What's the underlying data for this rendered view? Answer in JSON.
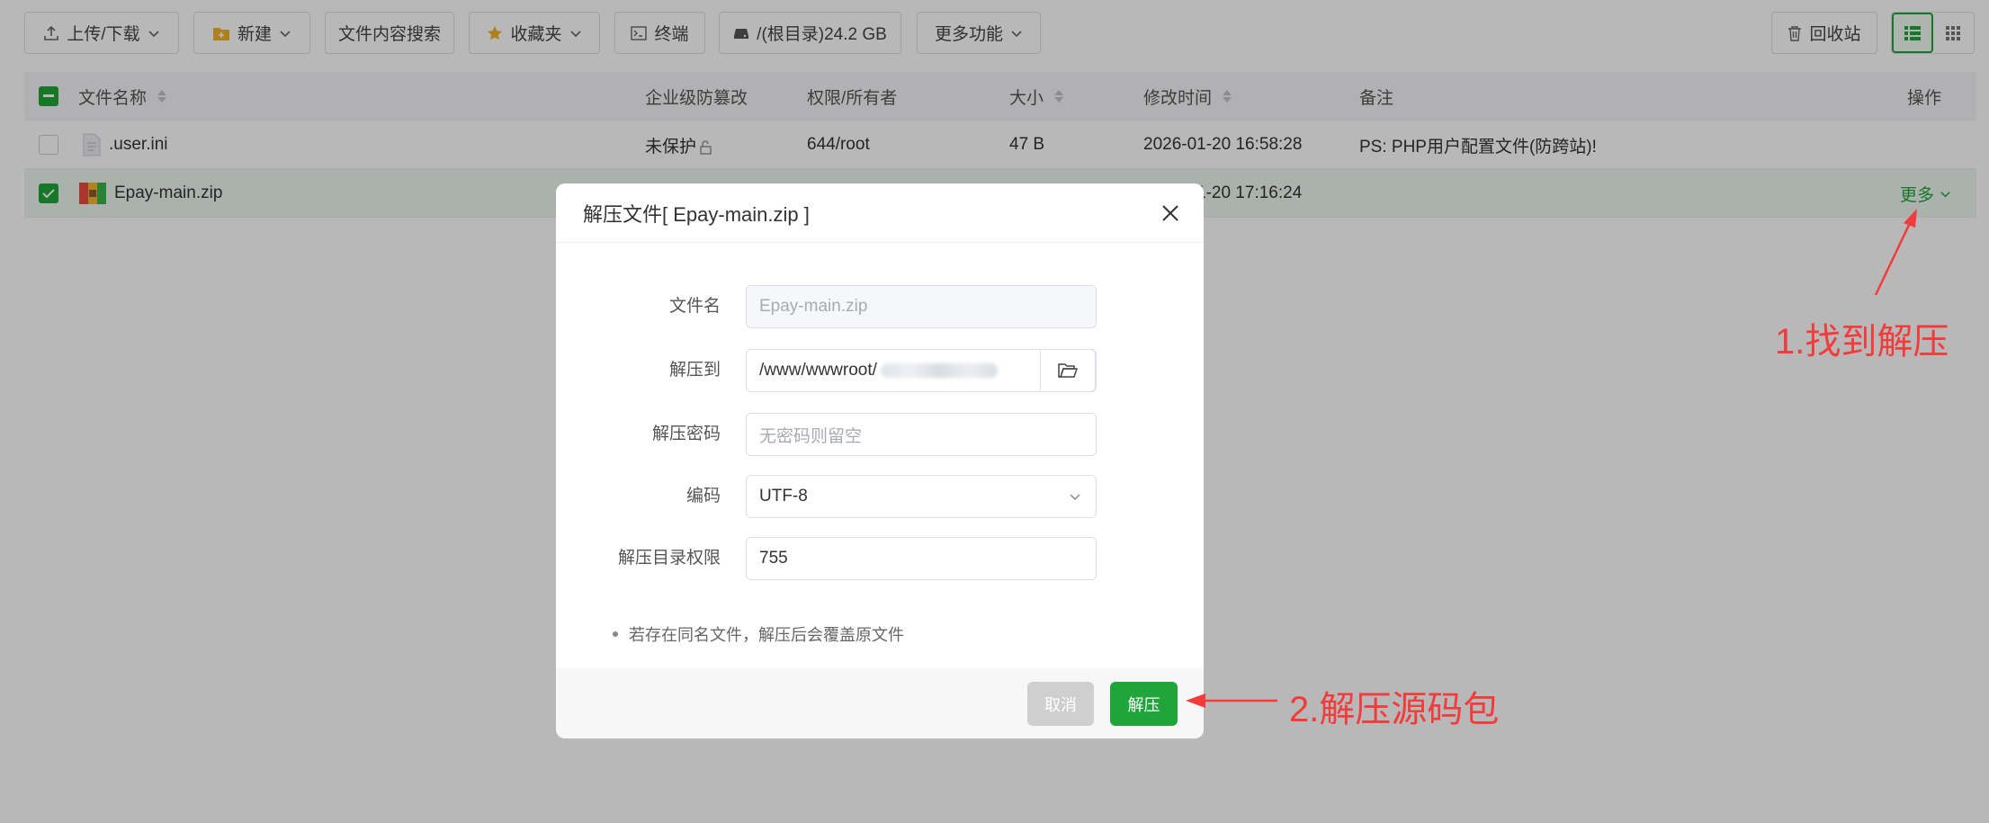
{
  "toolbar": {
    "upload_download": "上传/下载",
    "new": "新建",
    "content_search": "文件内容搜索",
    "favorites": "收藏夹",
    "terminal": "终端",
    "disk": "/(根目录)24.2 GB",
    "more_functions": "更多功能",
    "recycle_bin": "回收站"
  },
  "table": {
    "headers": {
      "name": "文件名称",
      "tamper": "企业级防篡改",
      "permission": "权限/所有者",
      "size": "大小",
      "mtime": "修改时间",
      "remark": "备注",
      "action": "操作"
    },
    "rows": [
      {
        "name": ".user.ini",
        "tamper": "未保护",
        "permission": "644/root",
        "size": "47 B",
        "mtime": "2026-01-20 16:58:28",
        "remark": "PS: PHP用户配置文件(防跨站)!"
      },
      {
        "name": "Epay-main.zip",
        "mtime_visible": "1-20 17:16:24",
        "action": "更多"
      }
    ]
  },
  "dialog": {
    "title": "解压文件[ Epay-main.zip ]",
    "filename_label": "文件名",
    "filename_value": "Epay-main.zip",
    "extract_to_label": "解压到",
    "extract_to_value": "/www/wwwroot/",
    "password_label": "解压密码",
    "password_placeholder": "无密码则留空",
    "encoding_label": "编码",
    "encoding_value": "UTF-8",
    "dir_perm_label": "解压目录权限",
    "dir_perm_value": "755",
    "note": "若存在同名文件，解压后会覆盖原文件",
    "cancel": "取消",
    "confirm": "解压"
  },
  "annotations": {
    "step1": "1.找到解压",
    "step2": "2.解压源码包"
  },
  "colors": {
    "accent": "#20a53a",
    "annotation": "#f23b3b",
    "cancel_disabled": "#cfcfcf"
  }
}
